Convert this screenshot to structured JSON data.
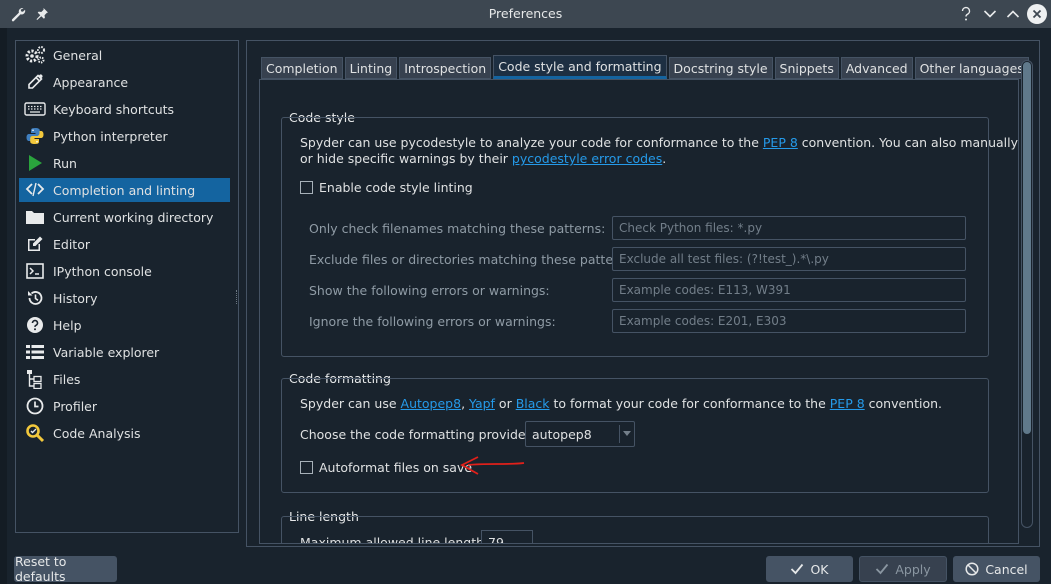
{
  "window": {
    "title": "Preferences"
  },
  "sidebar": {
    "items": [
      {
        "label": "General",
        "icon": "gears-icon"
      },
      {
        "label": "Appearance",
        "icon": "eyedropper-icon"
      },
      {
        "label": "Keyboard shortcuts",
        "icon": "keyboard-icon"
      },
      {
        "label": "Python interpreter",
        "icon": "python-icon"
      },
      {
        "label": "Run",
        "icon": "play-icon"
      },
      {
        "label": "Completion and linting",
        "icon": "code-icon"
      },
      {
        "label": "Current working directory",
        "icon": "folder-icon"
      },
      {
        "label": "Editor",
        "icon": "edit-icon"
      },
      {
        "label": "IPython console",
        "icon": "terminal-icon"
      },
      {
        "label": "History",
        "icon": "history-icon"
      },
      {
        "label": "Help",
        "icon": "help-icon"
      },
      {
        "label": "Variable explorer",
        "icon": "list-icon"
      },
      {
        "label": "Files",
        "icon": "files-icon"
      },
      {
        "label": "Profiler",
        "icon": "clock-icon"
      },
      {
        "label": "Code Analysis",
        "icon": "code-analysis-icon"
      }
    ],
    "selected": "Completion and linting"
  },
  "tabs": [
    "Completion",
    "Linting",
    "Introspection",
    "Code style and formatting",
    "Docstring style",
    "Snippets",
    "Advanced",
    "Other languages"
  ],
  "selected_tab": "Code style and formatting",
  "code_style": {
    "title": "Code style",
    "desc1_pre": "Spyder can use pycodestyle to analyze your code for conformance to the ",
    "desc1_link": "PEP 8",
    "desc1_post": " convention. You can also manually show",
    "desc2_pre": "or hide specific warnings by their ",
    "desc2_link": "pycodestyle error codes",
    "desc2_post": ".",
    "enable_label": "Enable code style linting",
    "fields": [
      {
        "label": "Only check filenames matching these patterns:",
        "placeholder": "Check Python files: *.py"
      },
      {
        "label": "Exclude files or directories matching these patterns:",
        "placeholder": "Exclude all test files: (?!test_).*\\.py"
      },
      {
        "label": "Show the following errors or warnings:",
        "placeholder": "Example codes: E113, W391"
      },
      {
        "label": "Ignore the following errors or warnings:",
        "placeholder": "Example codes: E201, E303"
      }
    ]
  },
  "code_formatting": {
    "title": "Code formatting",
    "desc_1": "Spyder can use ",
    "link_autopep8": "Autopep8",
    "sep_1": ", ",
    "link_yapf": "Yapf",
    "sep_2": " or ",
    "link_black": "Black",
    "desc_2": " to format your code for conformance to the ",
    "link_pep8": "PEP 8",
    "desc_3": " convention.",
    "provider_label": "Choose the code formatting provider:",
    "provider_value": "autopep8",
    "autoformat_label": "Autoformat files on save"
  },
  "line_length": {
    "title": "Line length",
    "max_label": "Maximum allowed line length:",
    "max_value": "79"
  },
  "buttons": {
    "reset": "Reset to defaults",
    "ok": "OK",
    "apply": "Apply",
    "cancel": "Cancel"
  },
  "colors": {
    "accent": "#1464a0",
    "link": "#259ae9",
    "annotation": "#e0201a"
  }
}
